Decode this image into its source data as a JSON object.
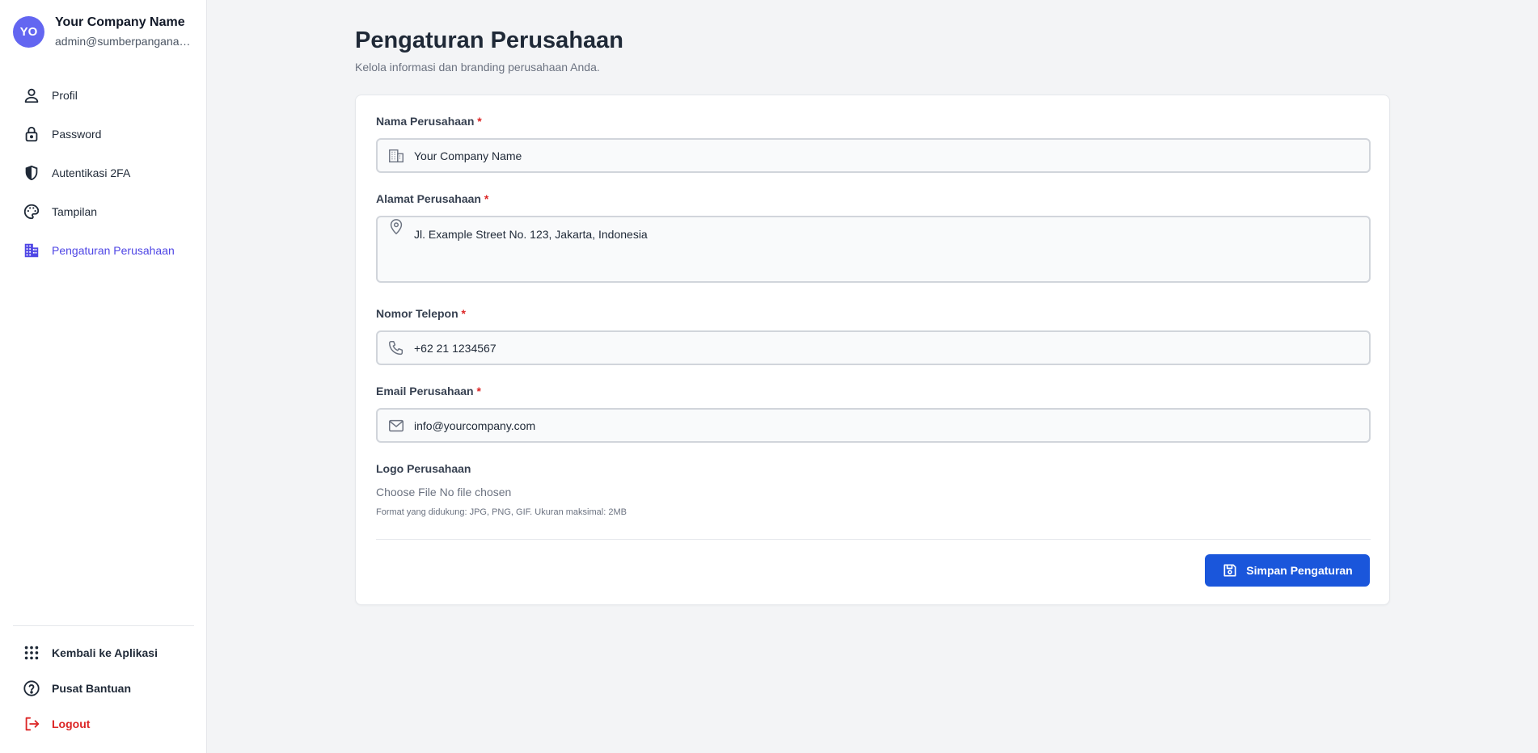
{
  "user": {
    "initials": "YO",
    "name": "Your Company Name",
    "email": "admin@sumberpanganab..."
  },
  "sidebar": {
    "items": [
      {
        "label": "Profil",
        "icon": "user-icon"
      },
      {
        "label": "Password",
        "icon": "lock-icon"
      },
      {
        "label": "Autentikasi 2FA",
        "icon": "shield-icon"
      },
      {
        "label": "Tampilan",
        "icon": "palette-icon"
      },
      {
        "label": "Pengaturan Perusahaan",
        "icon": "building-icon",
        "active": true
      }
    ],
    "bottom": [
      {
        "label": "Kembali ke Aplikasi",
        "icon": "apps-grid-icon"
      },
      {
        "label": "Pusat Bantuan",
        "icon": "help-circle-icon"
      },
      {
        "label": "Logout",
        "icon": "logout-icon"
      }
    ]
  },
  "page": {
    "title": "Pengaturan Perusahaan",
    "subtitle": "Kelola informasi dan branding perusahaan Anda."
  },
  "form": {
    "required_mark": "*",
    "company_name": {
      "label": "Nama Perusahaan",
      "value": "Your Company Name",
      "icon": "building-icon"
    },
    "company_address": {
      "label": "Alamat Perusahaan",
      "value": "Jl. Example Street No. 123, Jakarta, Indonesia",
      "icon": "map-pin-icon"
    },
    "phone": {
      "label": "Nomor Telepon",
      "value": "+62 21 1234567",
      "icon": "phone-icon"
    },
    "email": {
      "label": "Email Perusahaan",
      "value": "info@yourcompany.com",
      "icon": "mail-icon"
    },
    "logo": {
      "label": "Logo Perusahaan",
      "choose_label": "Choose File",
      "status": "No file chosen",
      "hint": "Format yang didukung: JPG, PNG, GIF. Ukuran maksimal: 2MB"
    },
    "save_label": "Simpan Pengaturan"
  },
  "colors": {
    "accent": "#4f46e5",
    "primary_button": "#1a56db",
    "avatar": "#6366f1",
    "danger": "#dc2626"
  }
}
